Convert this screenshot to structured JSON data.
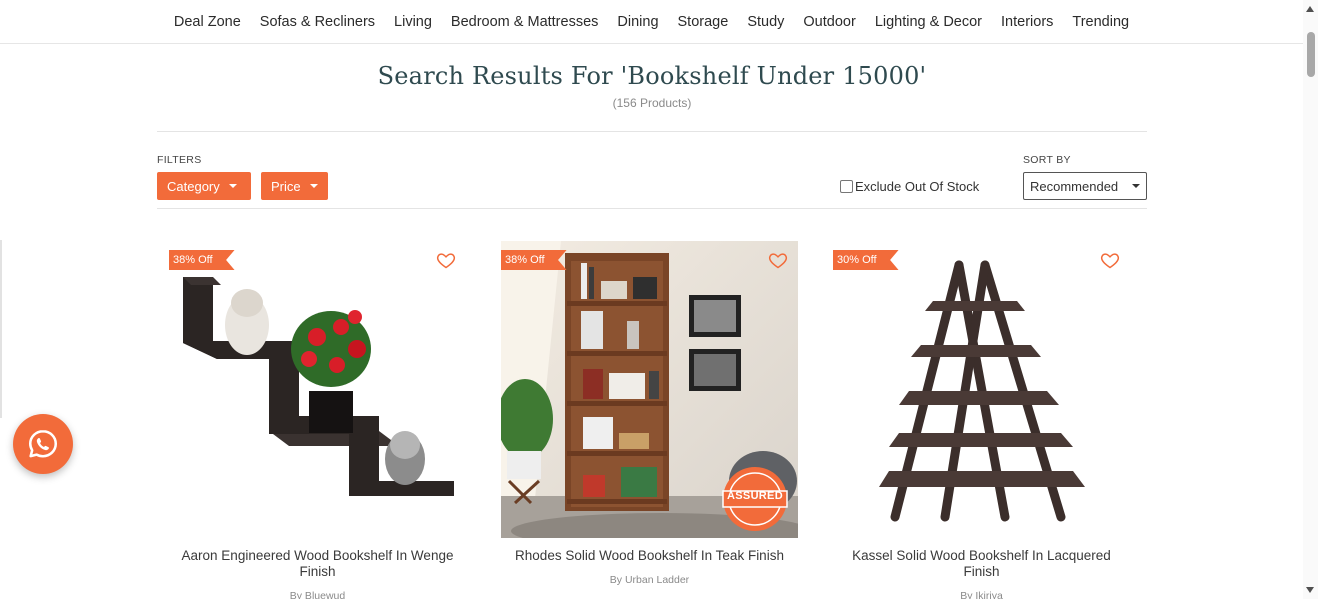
{
  "nav": {
    "items": [
      "Deal Zone",
      "Sofas & Recliners",
      "Living",
      "Bedroom & Mattresses",
      "Dining",
      "Storage",
      "Study",
      "Outdoor",
      "Lighting & Decor",
      "Interiors",
      "Trending"
    ]
  },
  "search": {
    "title": "Search Results For 'Bookshelf Under 15000'",
    "count": "(156 Products)"
  },
  "filters": {
    "label": "FILTERS",
    "category": "Category",
    "price": "Price",
    "exclude_out_of_stock": "Exclude Out Of Stock"
  },
  "sort": {
    "label": "SORT BY",
    "selected": "Recommended"
  },
  "products": [
    {
      "discount": "38% Off",
      "name": "Aaron Engineered Wood Bookshelf In Wenge Finish",
      "brand": "By Bluewud"
    },
    {
      "discount": "38% Off",
      "name": "Rhodes Solid Wood Bookshelf In Teak Finish",
      "brand": "By Urban Ladder",
      "assured_badge": "ASSURED"
    },
    {
      "discount": "30% Off",
      "name": "Kassel Solid Wood Bookshelf In Lacquered Finish",
      "brand": "By Ikiriya"
    }
  ],
  "colors": {
    "accent": "#f26b3a",
    "heading": "#2f4a4f"
  },
  "icons": {
    "wishlist": "heart-outline-icon",
    "chat": "whatsapp-icon"
  }
}
